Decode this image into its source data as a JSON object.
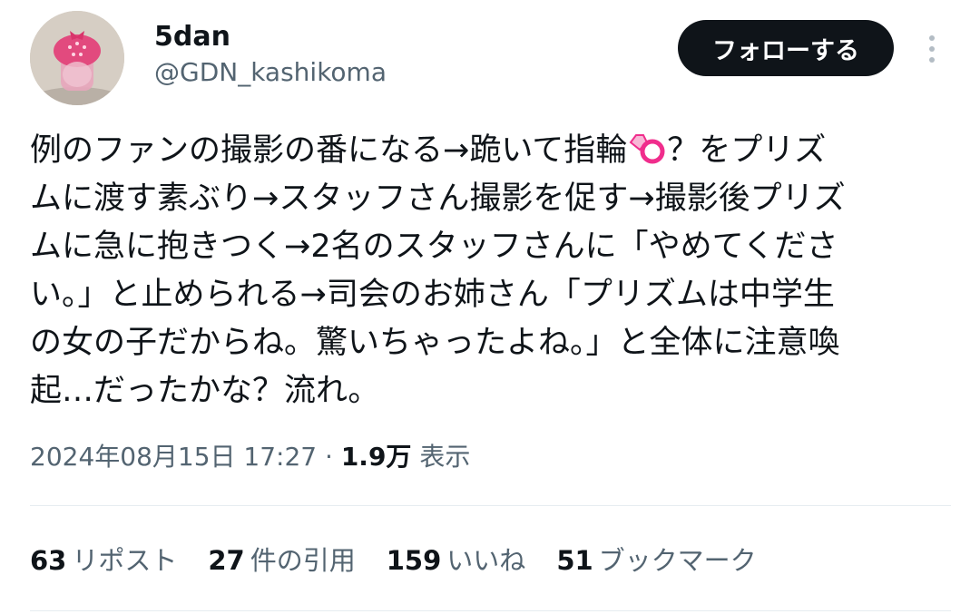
{
  "author": {
    "display_name": "5dan",
    "handle": "@GDN_kashikoma",
    "avatar_icon": "pink-strawberry-charm-avatar"
  },
  "follow_button": {
    "label": "フォローする"
  },
  "more_menu": {
    "icon": "more-vertical-icon"
  },
  "tweet": {
    "lines": [
      {
        "before": "例のファンの撮影の番になる→跪いて指輪",
        "emoji": "ring-emoji",
        "after": "？をプリズ"
      },
      {
        "text": "ムに渡す素ぶり→スタッフさん撮影を促す→撮影後プリズ"
      },
      {
        "text": "ムに急に抱きつく→2名のスタッフさんに「やめてくださ"
      },
      {
        "text": "い。」と止められる→司会のお姉さん「プリズムは中学生"
      },
      {
        "text": "の女の子だからね。驚いちゃったよね。」と全体に注意喚"
      },
      {
        "text": "起…だったかな？流れ。"
      }
    ]
  },
  "meta": {
    "timestamp": "2024年08月15日 17:27",
    "separator": "·",
    "views_count": "1.9万",
    "views_label": "表示"
  },
  "stats": {
    "reposts": {
      "count": "63",
      "label": "リポスト"
    },
    "quotes": {
      "count": "27",
      "label": "件の引用"
    },
    "likes": {
      "count": "159",
      "label": "いいね"
    },
    "bookmarks": {
      "count": "51",
      "label": "ブックマーク"
    }
  },
  "colors": {
    "text_primary": "#0f1419",
    "text_secondary": "#536471",
    "follow_bg": "#0f1419",
    "divider": "#e6ecf0",
    "ring_pink": "#f02d8c"
  }
}
